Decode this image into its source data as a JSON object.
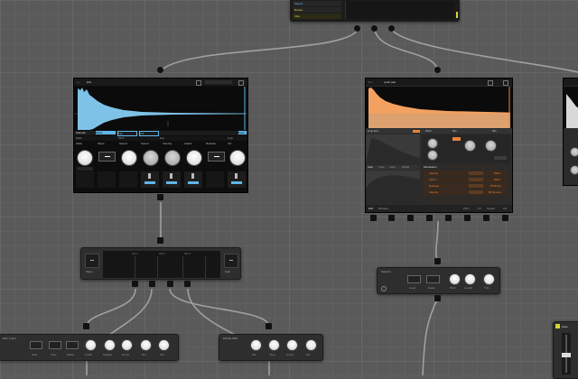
{
  "colors": {
    "accent_blue": "#5fb7e8",
    "accent_orange": "#e8823a",
    "accent_yellow": "#d7d43a",
    "wire": "#9a9a9a",
    "port": "#111111"
  },
  "top_panel": {
    "rows": [
      "Sapphi",
      "Bucket",
      "Vibe"
    ]
  },
  "sampler_left": {
    "title": "kick",
    "tabs": [
      "Sampler",
      "Mode",
      "Tab",
      "FIX"
    ],
    "tab_right": "Gate",
    "section_labels": [
      "Glide",
      "Pitch",
      "Env",
      "Amp"
    ],
    "params": [
      "Glide",
      "Slope",
      "Speed",
      "Speed",
      "Velocity",
      "Attack",
      "Release",
      "Vol"
    ]
  },
  "sampler_right": {
    "title": "synth pad",
    "sections": [
      "Amp Env",
      "Pitch",
      "Mix"
    ],
    "tabs": [
      "Gain",
      "Tune",
      "Voice",
      "ADSR"
    ],
    "modulation_title": "Modulation",
    "mod_rows": [
      {
        "source": "Velocity",
        "target": "Pitch"
      },
      {
        "source": "LFO 1",
        "target": "Pitch"
      },
      {
        "source": "Release",
        "target": "PTR Amt"
      },
      {
        "source": "Velocity",
        "target": "Bit Source"
      }
    ],
    "footer": [
      "Edit",
      "Modules"
    ],
    "footer_right": [
      "Pitch",
      "FX",
      "Output",
      "Vol"
    ]
  },
  "mixer": {
    "left_label": "Steps",
    "right_label": "Gain",
    "strips": [
      "CH 1",
      "CH 2",
      "CH 3",
      "CH 4",
      "CH 5"
    ]
  },
  "module_mid": {
    "title": "Selector",
    "labels": [
      "Level",
      "Scale",
      "Pitch",
      "Length",
      "Trim"
    ]
  },
  "module_bl": {
    "title": "ENV 1 ELV",
    "labels": [
      "Gain",
      "Time",
      "Offset",
      "Cutoff",
      "Sustain",
      "Fx Ctl",
      "Rel",
      "Out"
    ]
  },
  "module_bm": {
    "title": "ENVELOPE",
    "labels": [
      "Atk",
      "Time",
      "Curve",
      "Rel"
    ]
  },
  "side_right": {
    "label": "Gate"
  }
}
